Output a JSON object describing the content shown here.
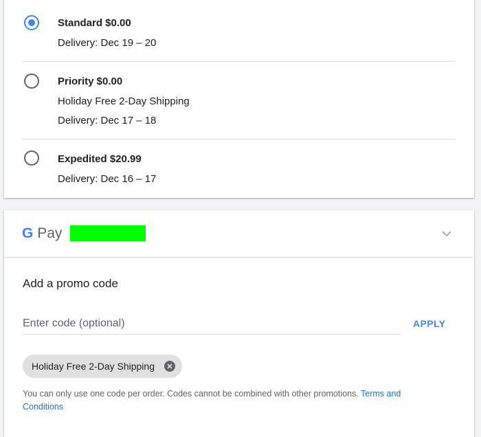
{
  "shipping": {
    "options": [
      {
        "title": "Standard $0.00",
        "lines": [
          "Delivery: Dec 19 – 20"
        ],
        "selected": true
      },
      {
        "title": "Priority $0.00",
        "lines": [
          "Holiday Free 2-Day Shipping",
          "Delivery: Dec 17 – 18"
        ],
        "selected": false
      },
      {
        "title": "Expedited $20.99",
        "lines": [
          "Delivery: Dec 16 – 17"
        ],
        "selected": false
      }
    ]
  },
  "payment": {
    "logo_g": "G",
    "logo_text": "Pay",
    "icon": "chevron-down-icon"
  },
  "promo": {
    "title": "Add a promo code",
    "placeholder": "Enter code (optional)",
    "apply_label": "APPLY",
    "applied_chip": "Holiday Free 2-Day Shipping",
    "note_text": "You can only use one code per order. Codes cannot be combined with other promotions.",
    "terms_link": "Terms and Conditions"
  },
  "colors": {
    "accent": "#4285f4",
    "link": "#1a73e8",
    "redacted_block": "#00ff00"
  }
}
